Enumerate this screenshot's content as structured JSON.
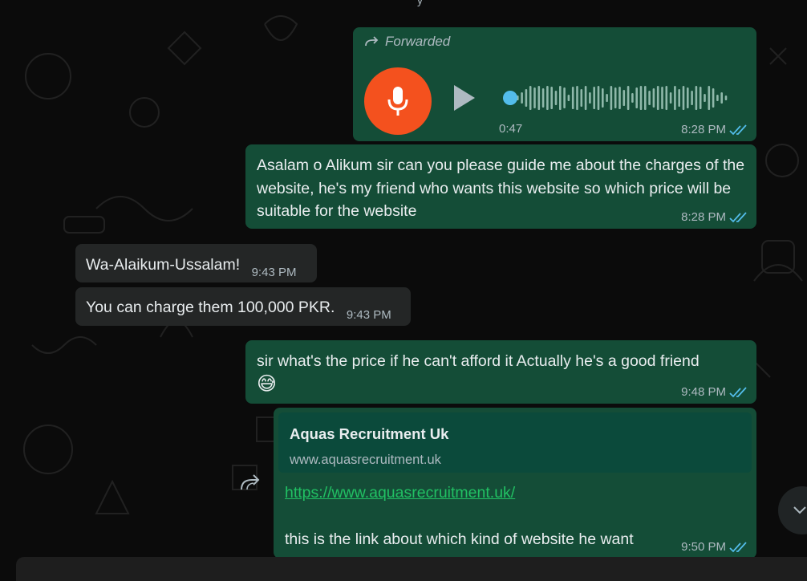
{
  "top_fragment": "y",
  "voice_message": {
    "forwarded_label": "Forwarded",
    "duration": "0:47",
    "time": "8:28 PM",
    "progress": 0
  },
  "messages": [
    {
      "text": "Asalam o Alikum sir can you please guide me about the charges of the website, he's my friend who wants this website so which price will be suitable for the website",
      "time": "8:28 PM"
    },
    {
      "text": "Wa-Alaikum-Ussalam!",
      "time": "9:43 PM"
    },
    {
      "text": "You can charge them 100,000 PKR.",
      "time": "9:43 PM"
    },
    {
      "text": "sir what's the price if he can't afford it Actually he's a good friend",
      "emoji": "😅",
      "time": "9:48 PM"
    }
  ],
  "link_message": {
    "preview_title": "Aquas Recruitment Uk",
    "preview_domain": "www.aquasrecruitment.uk",
    "url": "https://www.aquasrecruitment.uk/",
    "text": "this is the link about which kind of website he want",
    "time": "9:50 PM"
  },
  "icons": {
    "forward": "forward-arrow-icon",
    "mic": "microphone-icon",
    "play": "play-icon",
    "read": "double-check-icon",
    "scroll": "chevron-down-icon"
  },
  "colors": {
    "outgoing": "#144d37",
    "incoming": "#242626",
    "read_tick": "#53bdeb",
    "mic_avatar": "#f4511e"
  }
}
